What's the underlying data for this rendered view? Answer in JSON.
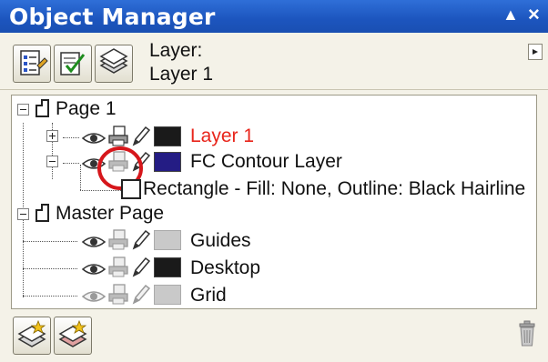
{
  "window": {
    "title": "Object Manager",
    "controls": {
      "collapse": "▲",
      "close": "×"
    }
  },
  "toolbar": {
    "buttons": [
      {
        "icon": "show-object-properties-icon"
      },
      {
        "icon": "edit-across-layers-icon"
      },
      {
        "icon": "layer-manager-view-icon"
      }
    ],
    "layer_label": "Layer:",
    "layer_value": "Layer 1",
    "menu_icon": "flyout-menu-icon"
  },
  "tree": {
    "page1": {
      "label": "Page 1"
    },
    "layer1": {
      "label": "Layer 1",
      "color": "#e8251b",
      "swatch": "#1a1a1a"
    },
    "contour": {
      "label": "FC Contour Layer",
      "swatch": "#241c84"
    },
    "rectangle": {
      "label": "Rectangle - Fill: None, Outline: Black  Hairline"
    },
    "master": {
      "label": "Master Page"
    },
    "guides": {
      "label": "Guides",
      "swatch": "#c9c9c9"
    },
    "desktop": {
      "label": "Desktop",
      "swatch": "#1a1a1a"
    },
    "grid": {
      "label": "Grid",
      "swatch": "#c9c9c9"
    }
  },
  "highlight": {
    "color": "#d6161b"
  },
  "bottom": {
    "buttons": [
      {
        "icon": "new-layer-icon"
      },
      {
        "icon": "new-master-layer-icon"
      }
    ],
    "delete_icon": "trash-icon"
  }
}
